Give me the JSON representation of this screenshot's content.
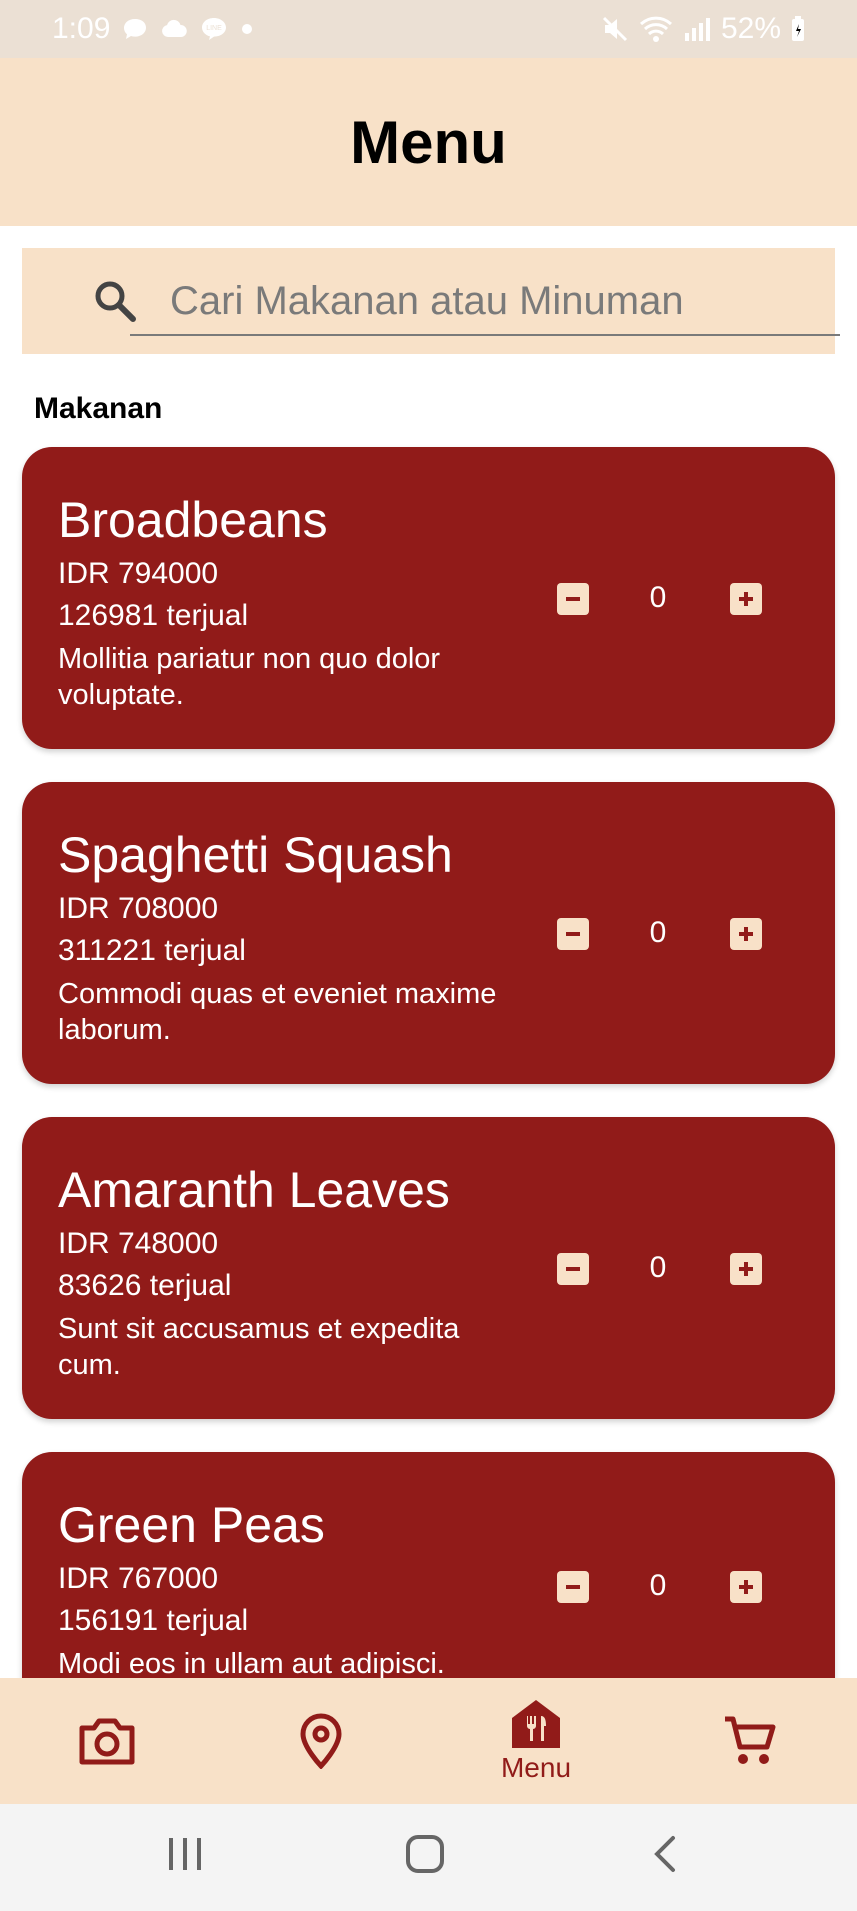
{
  "status_bar": {
    "time": "1:09",
    "battery": "52%",
    "icons": [
      "chat-bubble-icon",
      "cloud-icon",
      "line-icon",
      "dot-icon",
      "mute-icon",
      "wifi-icon",
      "signal-icon",
      "battery-icon"
    ]
  },
  "header": {
    "title": "Menu"
  },
  "search": {
    "placeholder": "Cari Makanan atau Minuman",
    "value": ""
  },
  "section": {
    "title": "Makanan"
  },
  "items": [
    {
      "name": "Broadbeans",
      "price": "IDR 794000",
      "sold": "126981 terjual",
      "description": "Mollitia pariatur non quo dolor voluptate.",
      "quantity": "0"
    },
    {
      "name": "Spaghetti Squash",
      "price": "IDR 708000",
      "sold": "311221 terjual",
      "description": "Commodi quas et eveniet maxime laborum.",
      "quantity": "0"
    },
    {
      "name": "Amaranth Leaves",
      "price": "IDR 748000",
      "sold": "83626 terjual",
      "description": "Sunt sit accusamus et expedita cum.",
      "quantity": "0"
    },
    {
      "name": "Green Peas",
      "price": "IDR 767000",
      "sold": "156191 terjual",
      "description": "Modi eos in ullam aut adipisci.",
      "quantity": "0"
    }
  ],
  "bottom_nav": {
    "items": [
      {
        "icon": "camera-icon",
        "label": ""
      },
      {
        "icon": "location-pin-icon",
        "label": ""
      },
      {
        "icon": "restaurant-menu-icon",
        "label": "Menu"
      },
      {
        "icon": "cart-icon",
        "label": ""
      }
    ],
    "active_index": 2
  },
  "colors": {
    "accent": "#911b19",
    "surface": "#f8e1c8",
    "status_bar": "#ebe0d4"
  }
}
